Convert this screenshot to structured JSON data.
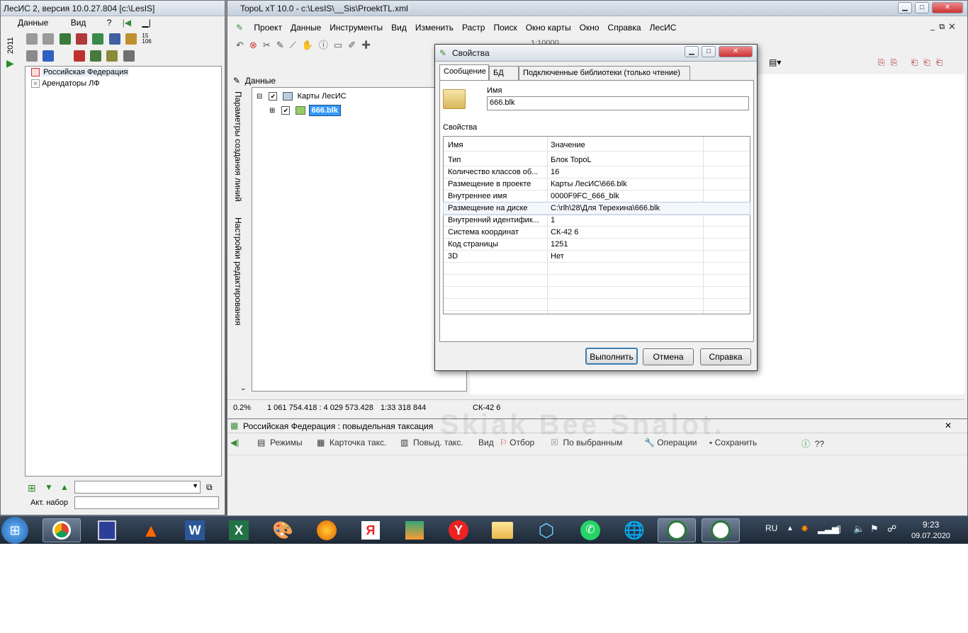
{
  "left_window": {
    "title": "ЛесИС 2, версия 10.0.27.804  [c:\\LesIS]",
    "menu": {
      "data": "Данные",
      "view": "Вид",
      "help": "?"
    },
    "year_tab": "2011",
    "tree": [
      "Российская Федерация",
      "Арендаторы ЛФ"
    ],
    "act_set_label": "Акт. набор",
    "toolbar_numbers": [
      "15",
      "106"
    ]
  },
  "main_window": {
    "title": "TopoL xT 10.0 - c:\\LesIS\\__Sis\\ProektTL.xml",
    "menu": [
      "Проект",
      "Данные",
      "Инструменты",
      "Вид",
      "Изменить",
      "Растр",
      "Поиск",
      "Окно карты",
      "Окно",
      "Справка",
      "ЛесИС"
    ],
    "scale": "1:10000",
    "panel_title": "Данные",
    "vertical_tabs": [
      "Параметры создания линий",
      "Настройки редактирования"
    ],
    "tree": {
      "root": "Карты ЛесИС",
      "child": "666.blk"
    },
    "status": {
      "percent": "0.2%",
      "coords": "1 061 754.418 : 4 029 573.428",
      "scale": "1:33 318 844",
      "crs": "СК-42 6"
    }
  },
  "sub_window": {
    "title": "Российская Федерация : повыдельная таксация",
    "tools": [
      "Режимы",
      "Карточка такс.",
      "Повыд. такс.",
      "Вид",
      "Отбор",
      "По выбранным",
      "Операции",
      "Сохранить",
      "??"
    ],
    "bg_text": "Skiak Bee Snalot."
  },
  "dialog": {
    "title": "Свойства",
    "tabs": [
      "Сообщение",
      "БД",
      "Подключенные библиотеки (только чтение)"
    ],
    "name_label": "Имя",
    "name_value": "666.blk",
    "props_label": "Свойства",
    "columns": [
      "Имя",
      "Значение"
    ],
    "rows": [
      {
        "name": "Тип",
        "value": "Блок TopoL"
      },
      {
        "name": "Количество классов об...",
        "value": "16"
      },
      {
        "name": "Размещение в проекте",
        "value": "Карты ЛесИС\\666.blk"
      },
      {
        "name": "Внутреннее имя",
        "value": "0000F9FC_666_blk"
      },
      {
        "name": "Размещение на диске",
        "value": "C:\\rlh\\28\\Для Терехина\\666.blk"
      },
      {
        "name": "Внутренний идентифик...",
        "value": "1"
      },
      {
        "name": "Система  координат",
        "value": "СК-42 6"
      },
      {
        "name": "Код страницы",
        "value": "1251"
      },
      {
        "name": "3D",
        "value": "Нет"
      }
    ],
    "buttons": {
      "ok": "Выполнить",
      "cancel": "Отмена",
      "help": "Справка"
    }
  },
  "taskbar": {
    "lang": "RU",
    "time": "9:23",
    "date": "09.07.2020",
    "apps": [
      "start",
      "chrome",
      "save",
      "vlc",
      "word",
      "excel",
      "paint",
      "firefox",
      "yandex",
      "store",
      "yandex-browser",
      "explorer",
      "virtualbox",
      "whatsapp",
      "network",
      "lesis",
      "topol"
    ]
  },
  "colors": {
    "accent": "#3c7fb1",
    "selection": "#3399ff"
  }
}
